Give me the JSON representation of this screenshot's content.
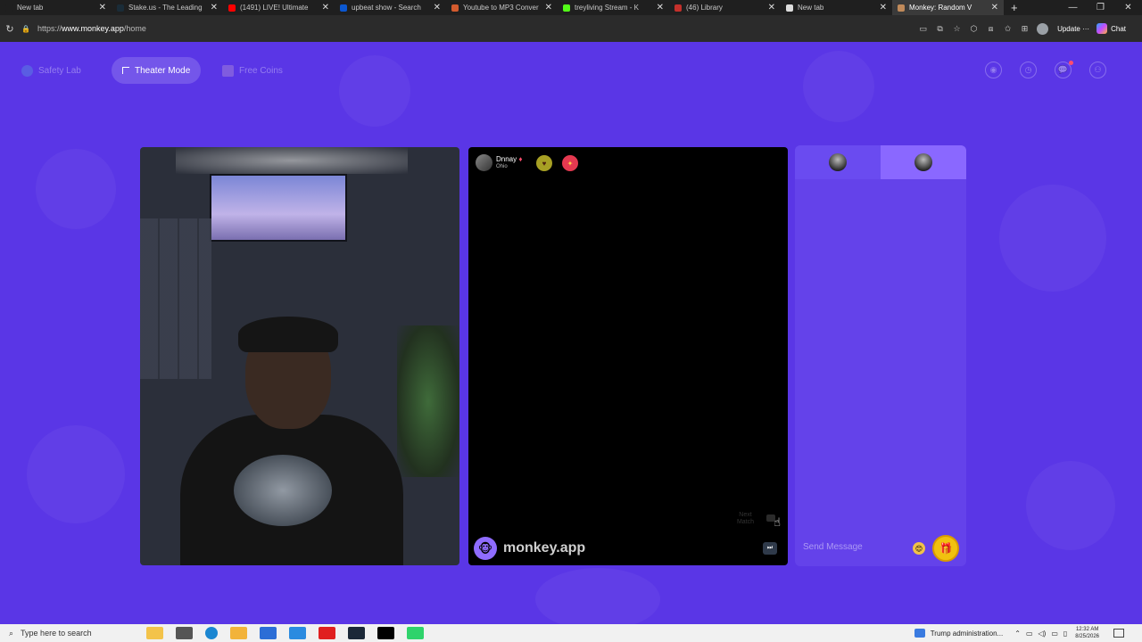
{
  "browser": {
    "tabs": [
      {
        "title": "New tab",
        "color": "#1f1f1f",
        "active": false
      },
      {
        "title": "Stake.us - The Leading",
        "color": "#1a2c38",
        "active": false
      },
      {
        "title": "(1491) LIVE! Ultimate",
        "color": "#ff0000",
        "active": false
      },
      {
        "title": "upbeat show - Search",
        "color": "#0b57d0",
        "active": false
      },
      {
        "title": "Youtube to MP3 Conver",
        "color": "#d35b2e",
        "active": false
      },
      {
        "title": "treyliving Stream - K",
        "color": "#53fc18",
        "active": false
      },
      {
        "title": "(46) Library",
        "color": "#c4302b",
        "active": false
      },
      {
        "title": "New tab",
        "color": "#dddddd",
        "active": false
      },
      {
        "title": "Monkey: Random V",
        "color": "#c08a5a",
        "active": true
      }
    ],
    "url_prefix": "https://",
    "url_host": "www.monkey.app",
    "url_path": "/home",
    "update_label": "Update",
    "chat_label": "Chat"
  },
  "nav": {
    "safety_lab": "Safety Lab",
    "theater_mode": "Theater Mode",
    "free_coins": "Free Coins"
  },
  "peer": {
    "name": "Dnnay",
    "location": "Ohio"
  },
  "remote": {
    "next_match_line1": "Next",
    "next_match_line2": "Match",
    "brand": "monkey.app"
  },
  "chat": {
    "placeholder": "Send Message"
  },
  "taskbar": {
    "search_placeholder": "Type here to search",
    "news": "Trump administration...",
    "time": "12:32 AM",
    "date": "8/25/2026"
  },
  "colors": {
    "page_bg": "#5a36e6",
    "chat_panel": "#6442ea",
    "accent_gift": "#f1c10f"
  }
}
